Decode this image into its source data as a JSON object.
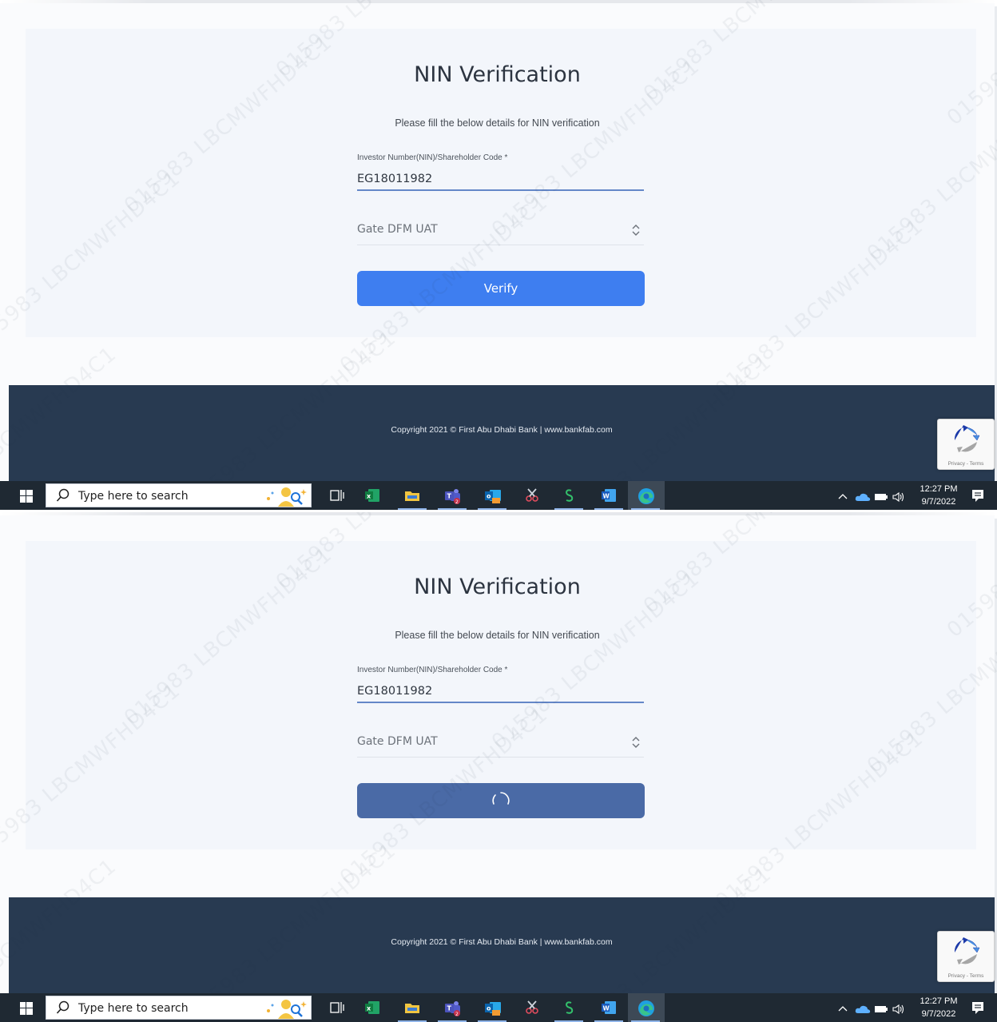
{
  "screens": [
    {
      "title": "NIN Verification",
      "subtitle": "Please fill the below details for NIN verification",
      "nin_label": "Investor Number(NIN)/Shareholder Code *",
      "nin_value": "EG18011982",
      "gateway_value": "Gate DFM UAT",
      "verify_label": "Verify",
      "verify_state": "idle",
      "copyright": "Copyright 2021 © First Abu Dhabi Bank | www.bankfab.com",
      "recaptcha_links": "Privacy - Terms"
    },
    {
      "title": "NIN Verification",
      "subtitle": "Please fill the below details for NIN verification",
      "nin_label": "Investor Number(NIN)/Shareholder Code *",
      "nin_value": "EG18011982",
      "gateway_value": "Gate DFM UAT",
      "verify_label": "",
      "verify_state": "loading",
      "copyright": "Copyright 2021 © First Abu Dhabi Bank | www.bankfab.com",
      "recaptcha_links": "Privacy - Terms"
    }
  ],
  "watermark_text": "015983 LBCMWFHD4C1",
  "taskbar": {
    "search_placeholder": "Type here to search",
    "time": "12:27 PM",
    "date": "9/7/2022",
    "apps": [
      "task-view-icon",
      "excel-icon",
      "file-explorer-icon",
      "teams-icon",
      "outlook-icon",
      "snipping-icon",
      "sigma-app-icon",
      "word-icon",
      "edge-icon"
    ]
  },
  "colors": {
    "primary_button": "#3e7ef0",
    "loading_button": "#4a6aa6",
    "footer": "#283a51",
    "field_underline": "#6487c8"
  }
}
